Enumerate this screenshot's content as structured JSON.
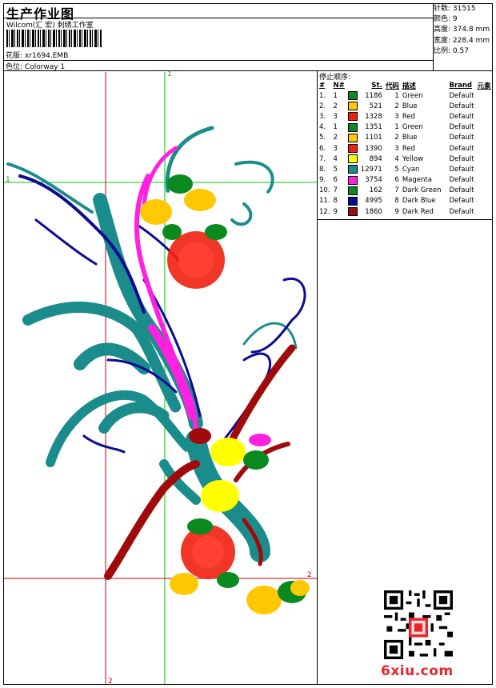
{
  "header": {
    "title": "生产作业图",
    "company": "Wilcom(汇 宏) 刺绣工作室",
    "design_label": "花版:",
    "design_file": "xr1694.EMB",
    "colorway_label": "色位:",
    "colorway": "Colorway 1"
  },
  "stats": [
    {
      "label": "针数:",
      "value": "31515"
    },
    {
      "label": "颜色:",
      "value": "9"
    },
    {
      "label": "高度:",
      "value": "374.8 mm"
    },
    {
      "label": "宽度:",
      "value": "228.4 mm"
    },
    {
      "label": "比例:",
      "value": "0.57"
    }
  ],
  "stop_sequence": {
    "title": "停止顺序:",
    "columns": [
      "#",
      "N#",
      "St.",
      "代码",
      "描述",
      "Brand",
      "元素"
    ],
    "rows": [
      {
        "idx": "1.",
        "n": "1",
        "color": "#0a8a1e",
        "st": "1186",
        "code": "1",
        "desc": "Green",
        "brand": "Default"
      },
      {
        "idx": "2.",
        "n": "2",
        "color": "#ffc800",
        "st": "521",
        "code": "2",
        "desc": "Blue",
        "brand": "Default"
      },
      {
        "idx": "3.",
        "n": "3",
        "color": "#f02010",
        "st": "1328",
        "code": "3",
        "desc": "Red",
        "brand": "Default"
      },
      {
        "idx": "4.",
        "n": "1",
        "color": "#0a8a1e",
        "st": "1351",
        "code": "1",
        "desc": "Green",
        "brand": "Default"
      },
      {
        "idx": "5.",
        "n": "2",
        "color": "#ffc800",
        "st": "1101",
        "code": "2",
        "desc": "Blue",
        "brand": "Default"
      },
      {
        "idx": "6.",
        "n": "3",
        "color": "#f02010",
        "st": "1390",
        "code": "3",
        "desc": "Red",
        "brand": "Default"
      },
      {
        "idx": "7.",
        "n": "4",
        "color": "#ffff00",
        "st": "894",
        "code": "4",
        "desc": "Yellow",
        "brand": "Default"
      },
      {
        "idx": "8.",
        "n": "5",
        "color": "#1a8c8c",
        "st": "12971",
        "code": "5",
        "desc": "Cyan",
        "brand": "Default"
      },
      {
        "idx": "9.",
        "n": "6",
        "color": "#ff20e0",
        "st": "3754",
        "code": "6",
        "desc": "Magenta",
        "brand": "Default"
      },
      {
        "idx": "10.",
        "n": "7",
        "color": "#0a8a1e",
        "st": "162",
        "code": "7",
        "desc": "Dark Green",
        "brand": "Default"
      },
      {
        "idx": "11.",
        "n": "8",
        "color": "#0a0a96",
        "st": "4995",
        "code": "8",
        "desc": "Dark Blue",
        "brand": "Default"
      },
      {
        "idx": "12.",
        "n": "9",
        "color": "#a00a0a",
        "st": "1860",
        "code": "9",
        "desc": "Dark Red",
        "brand": "Default"
      }
    ]
  },
  "guides": {
    "top": "1",
    "left": "1",
    "right": "2",
    "bottom": "2"
  },
  "watermark": {
    "site": "6xiu.com",
    "qr_icon": "qr-code-icon"
  },
  "colors": {
    "green": "#0a8a1e",
    "yellow": "#ffc800",
    "red": "#f02010",
    "cyan": "#1a8c8c",
    "magenta": "#ff20e0",
    "dark_blue": "#0a0a96",
    "dark_red": "#a00a0a",
    "guide_green": "#00cc00",
    "guide_red": "#cc0000"
  }
}
